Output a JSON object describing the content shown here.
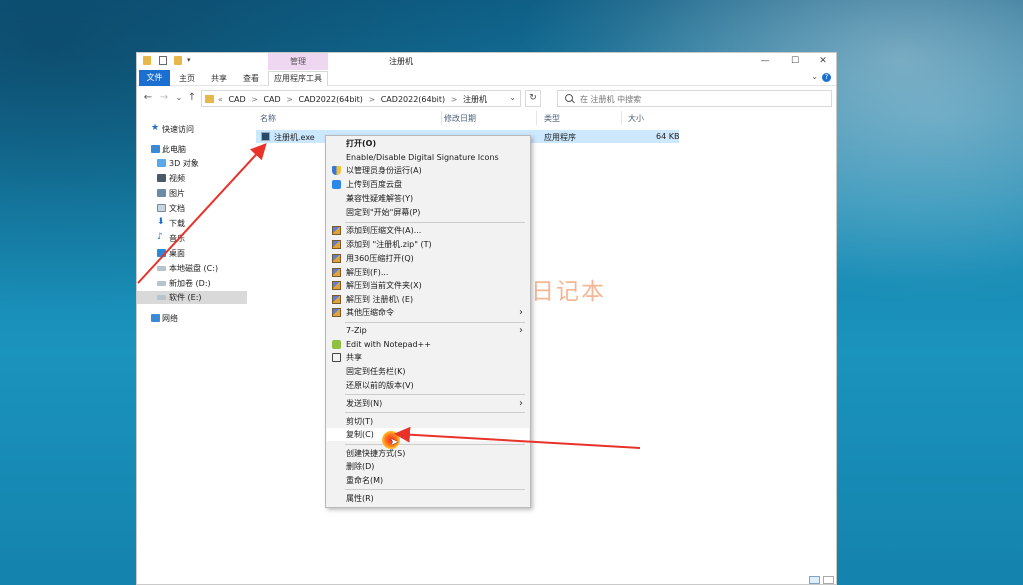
{
  "window": {
    "title": "注册机",
    "manage_tab": "管理",
    "quick_access_caret": "▾",
    "controls": {
      "minimize": "—",
      "maximize": "☐",
      "close": "✕"
    }
  },
  "ribbon": {
    "tabs": [
      "文件",
      "主页",
      "共享",
      "查看",
      "应用程序工具"
    ],
    "collapse_caret": "⌄",
    "help": "?"
  },
  "navbar": {
    "back": "←",
    "forward": "→",
    "recent": "⌄",
    "up": "↑",
    "breadcrumbs": [
      "«",
      "CAD",
      ">",
      "CAD",
      ">",
      "CAD2022(64bit)",
      ">",
      "CAD2022(64bit)",
      ">",
      "注册机"
    ],
    "dropdown": "⌄",
    "refresh": "↻",
    "search_placeholder": "在 注册机 中搜索"
  },
  "sidebar": {
    "items": [
      {
        "label": "快速访问",
        "icon": "star-icon"
      },
      {
        "label": "此电脑",
        "icon": "pc-icon"
      },
      {
        "label": "3D 对象",
        "icon": "3d-objects-icon"
      },
      {
        "label": "视频",
        "icon": "video-icon"
      },
      {
        "label": "图片",
        "icon": "pictures-icon"
      },
      {
        "label": "文档",
        "icon": "documents-icon"
      },
      {
        "label": "下载",
        "icon": "download-icon"
      },
      {
        "label": "音乐",
        "icon": "music-icon"
      },
      {
        "label": "桌面",
        "icon": "desktop-icon"
      },
      {
        "label": "本地磁盘 (C:)",
        "icon": "drive-icon"
      },
      {
        "label": "新加卷 (D:)",
        "icon": "drive-icon"
      },
      {
        "label": "软件 (E:)",
        "icon": "drive-icon"
      },
      {
        "label": "网络",
        "icon": "network-icon"
      }
    ],
    "selected": "软件 (E:)"
  },
  "file_list": {
    "columns": [
      "名称",
      "修改日期",
      "类型",
      "大小"
    ],
    "rows": [
      {
        "name": "注册机.exe",
        "type": "应用程序",
        "size": "64 KB"
      }
    ]
  },
  "context_menu": {
    "groups": [
      [
        {
          "label": "打开(O)",
          "bold": true
        },
        {
          "label": "Enable/Disable Digital Signature Icons"
        },
        {
          "label": "以管理员身份运行(A)",
          "icon": "shield-icon"
        },
        {
          "label": "上传到百度云盘",
          "icon": "baidu-cloud-icon"
        },
        {
          "label": "兼容性疑难解答(Y)"
        },
        {
          "label": "固定到\"开始\"屏幕(P)"
        }
      ],
      [
        {
          "label": "添加到压缩文件(A)...",
          "icon": "archive-icon"
        },
        {
          "label": "添加到 \"注册机.zip\" (T)",
          "icon": "archive-icon"
        },
        {
          "label": "用360压缩打开(Q)",
          "icon": "archive-icon"
        },
        {
          "label": "解压到(F)...",
          "icon": "archive-icon"
        },
        {
          "label": "解压到当前文件夹(X)",
          "icon": "archive-icon"
        },
        {
          "label": "解压到 注册机\\ (E)",
          "icon": "archive-icon"
        },
        {
          "label": "其他压缩命令",
          "icon": "archive-icon",
          "submenu": true
        }
      ],
      [
        {
          "label": "7-Zip",
          "submenu": true
        },
        {
          "label": "Edit with Notepad++",
          "icon": "notepad-icon"
        },
        {
          "label": "共享",
          "icon": "share-icon"
        },
        {
          "label": "固定到任务栏(K)"
        },
        {
          "label": "还原以前的版本(V)"
        }
      ],
      [
        {
          "label": "发送到(N)",
          "submenu": true
        }
      ],
      [
        {
          "label": "剪切(T)"
        },
        {
          "label": "复制(C)",
          "highlighted": true
        }
      ],
      [
        {
          "label": "创建快捷方式(S)"
        },
        {
          "label": "删除(D)"
        },
        {
          "label": "重命名(M)"
        }
      ],
      [
        {
          "label": "属性(R)"
        }
      ]
    ],
    "submenu_glyph": "›"
  },
  "watermark": {
    "text": "丁同学日记本"
  },
  "colors": {
    "accent": "#1a6fd1",
    "selection": "#cce8ff",
    "manage_tab": "#efd7f2",
    "arrow": "#e8322a"
  }
}
